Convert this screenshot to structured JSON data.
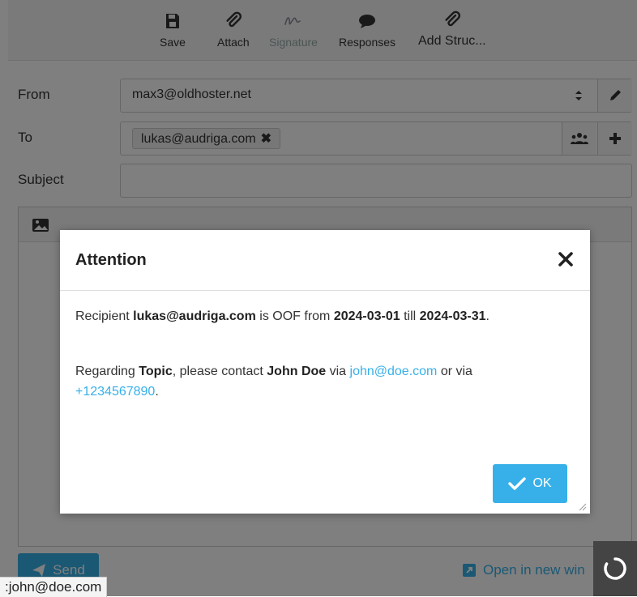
{
  "toolbar": {
    "save": "Save",
    "attach": "Attach",
    "signature": "Signature",
    "responses": "Responses",
    "add_structure": "Add Struc..."
  },
  "form": {
    "from_label": "From",
    "from_value": "max3@oldhoster.net",
    "to_label": "To",
    "to_recipient": "lukas@audriga.com",
    "subject_label": "Subject",
    "subject_value": ""
  },
  "footer": {
    "send": "Send",
    "open_new": "Open in new win"
  },
  "status_url": ":john@doe.com",
  "dialog": {
    "title": "Attention",
    "line1_pre": "Recipient ",
    "line1_recipient": "lukas@audriga.com",
    "line1_mid": " is OOF from ",
    "line1_from": "2024-03-01",
    "line1_till_word": " till ",
    "line1_till": "2024-03-31",
    "line1_end": ".",
    "line2_pre": "Regarding ",
    "line2_topic": "Topic",
    "line2_mid": ", please contact ",
    "line2_contact": "John Doe",
    "line2_via": " via ",
    "line2_email": "john@doe.com",
    "line2_or": " or via ",
    "line2_phone": "+1234567890",
    "line2_end": ".",
    "ok": "OK"
  },
  "colors": {
    "accent": "#37b0e9",
    "overlay": "rgba(0,0,0,0.5)"
  }
}
